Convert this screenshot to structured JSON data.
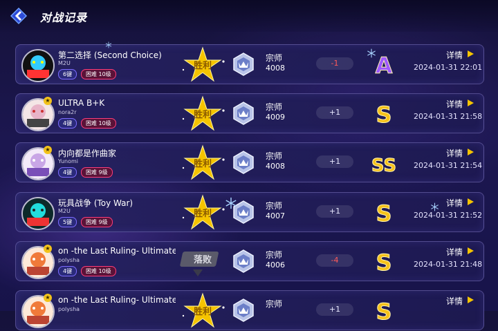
{
  "header": {
    "title": "对战记录"
  },
  "rows": [
    {
      "song": "第二选择 (Second Choice)",
      "artist": "M2U",
      "keys": "6键",
      "difficulty": "困难  10级",
      "result": "胜利",
      "rank_name": "宗师",
      "score": "4008",
      "change": "-1",
      "grade": "A",
      "date": "2024-01-31 22:01",
      "detail": "详情",
      "has_level_badge": false
    },
    {
      "song": "ULTRA B+K",
      "artist": "nora2r",
      "keys": "4键",
      "difficulty": "困难  10级",
      "result": "胜利",
      "rank_name": "宗师",
      "score": "4009",
      "change": "+1",
      "grade": "S",
      "date": "2024-01-31 21:58",
      "detail": "详情",
      "has_level_badge": true
    },
    {
      "song": "内向都是作曲家",
      "artist": "Yunomi",
      "keys": "4键",
      "difficulty": "困难  9级",
      "result": "胜利",
      "rank_name": "宗师",
      "score": "4008",
      "change": "+1",
      "grade": "SS",
      "date": "2024-01-31 21:54",
      "detail": "详情",
      "has_level_badge": true
    },
    {
      "song": "玩具战争 (Toy War)",
      "artist": "M2U",
      "keys": "5键",
      "difficulty": "困难  9级",
      "result": "胜利",
      "rank_name": "宗师",
      "score": "4007",
      "change": "+1",
      "grade": "S",
      "date": "2024-01-31 21:52",
      "detail": "详情",
      "has_level_badge": false
    },
    {
      "song": "on -the Last Ruling-   Ultimate We",
      "artist": "polysha",
      "keys": "4键",
      "difficulty": "困难  10级",
      "result": "落败",
      "rank_name": "宗师",
      "score": "4006",
      "change": "-4",
      "grade": "S",
      "date": "2024-01-31 21:48",
      "detail": "详情",
      "has_level_badge": true
    },
    {
      "song": "on -the Last Ruling-   Ultimate We",
      "artist": "polysha",
      "keys": "",
      "difficulty": "",
      "result": "胜利",
      "rank_name": "宗师",
      "score": "",
      "change": "+1",
      "grade": "S",
      "date": "",
      "detail": "详情",
      "has_level_badge": true
    }
  ],
  "colors": {
    "win_gold": "#f5c400",
    "loss_gray": "#5a5a6a",
    "grade_purple": "#a05aff",
    "grade_gold": "#f6c21a"
  }
}
